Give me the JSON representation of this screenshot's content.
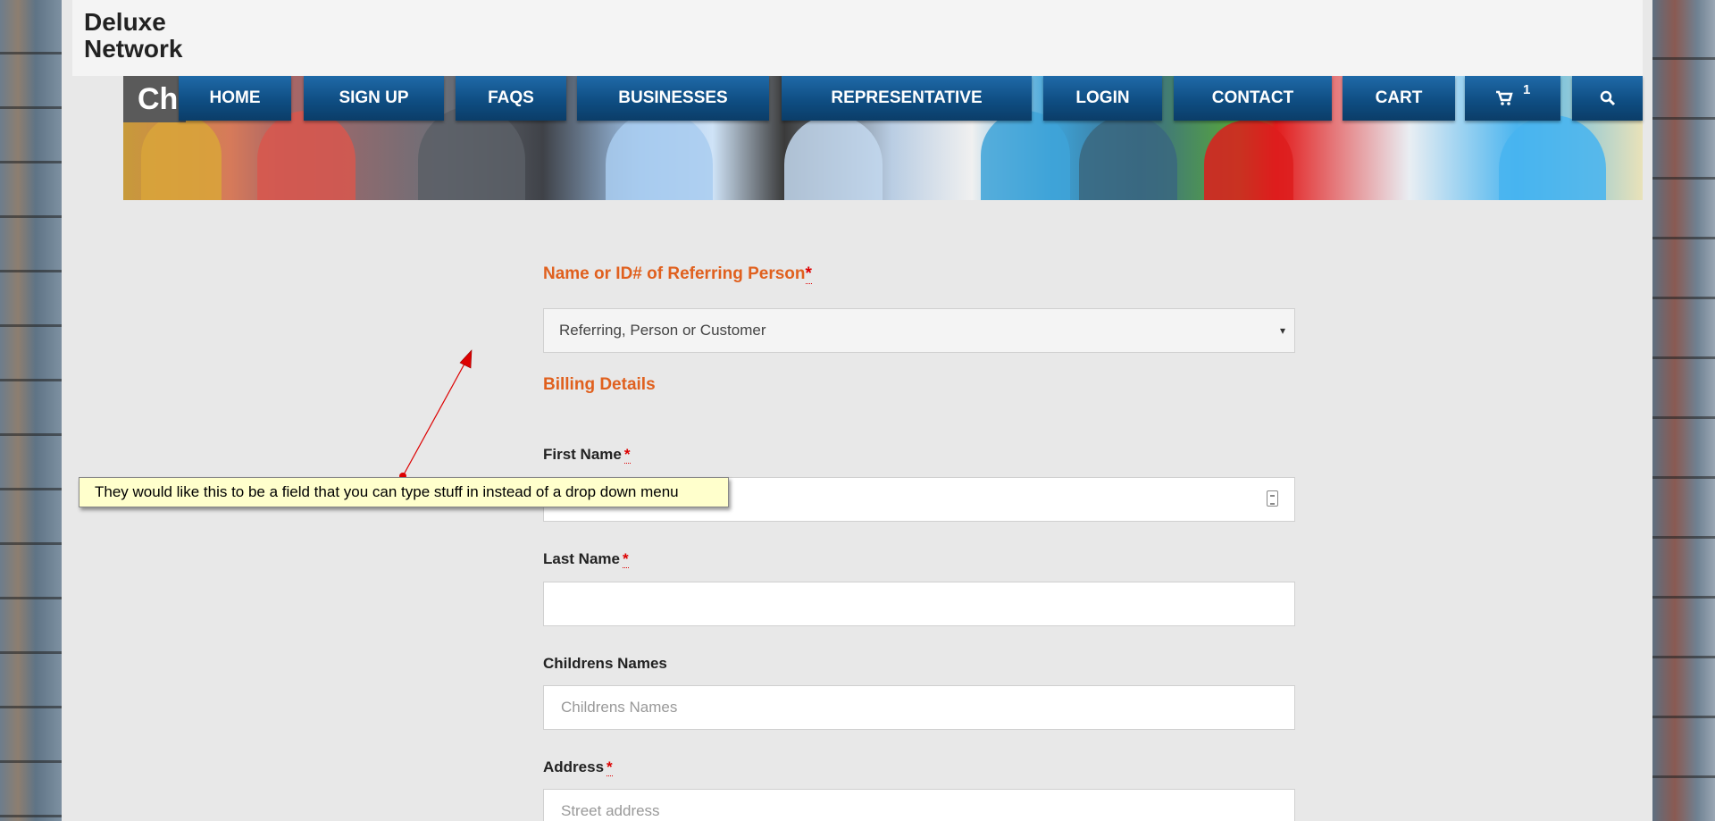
{
  "site": {
    "logo_line1": "Deluxe",
    "logo_line2": "Network",
    "page_title": "Ch"
  },
  "nav": {
    "items": [
      {
        "label": "HOME"
      },
      {
        "label": "SIGN UP"
      },
      {
        "label": "FAQS"
      },
      {
        "label": "BUSINESSES"
      },
      {
        "label": "REPRESENTATIVE"
      },
      {
        "label": "LOGIN"
      },
      {
        "label": "CONTACT"
      },
      {
        "label": "CART"
      }
    ],
    "cart_count": "1",
    "cart_icon": "cart-icon",
    "search_icon": "search-icon"
  },
  "form": {
    "referrer": {
      "label": "Name or ID# of Referring Person",
      "required_mark": "*",
      "selected": "Referring, Person or Customer",
      "arrow": "▾"
    },
    "billing_heading": "Billing Details",
    "first_name": {
      "label": "First Name",
      "required_mark": "*",
      "value": ""
    },
    "last_name": {
      "label": "Last Name",
      "required_mark": "*",
      "value": ""
    },
    "children": {
      "label": "Childrens Names",
      "placeholder": "Childrens Names"
    },
    "address": {
      "label": "Address",
      "required_mark": "*",
      "placeholder": "Street address"
    }
  },
  "annotation": {
    "text": "They would like this to be a field that you can type stuff in instead of a drop down menu"
  },
  "colors": {
    "nav_blue": "#0e4c80",
    "accent_orange": "#e0601e",
    "note_yellow": "#ffffcc"
  }
}
